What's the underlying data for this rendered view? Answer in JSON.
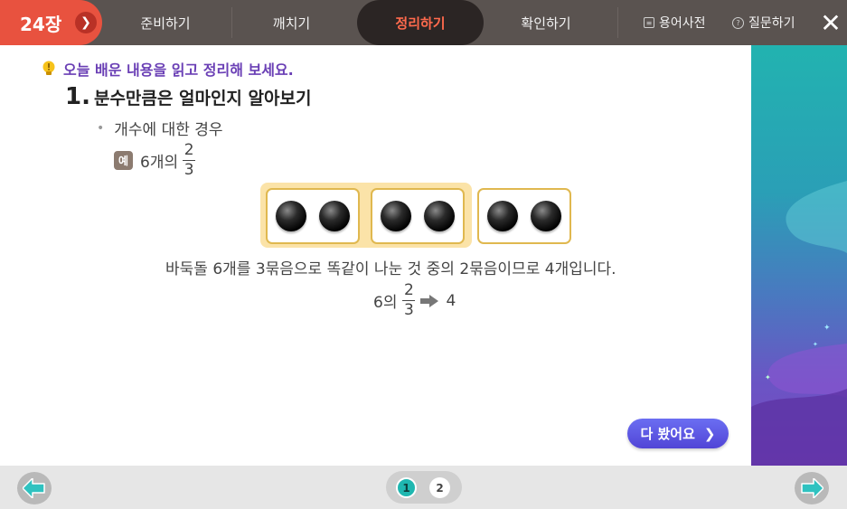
{
  "header": {
    "chapter_label": "24장",
    "tabs": [
      {
        "label": "준비하기"
      },
      {
        "label": "깨치기"
      },
      {
        "label": "정리하기"
      },
      {
        "label": "확인하기"
      }
    ],
    "active_tab": "정리하기",
    "dictionary_label": "용어사전",
    "question_label": "질문하기"
  },
  "content": {
    "goal": "오늘 배운 내용을 읽고 정리해 보세요.",
    "title_number": "1.",
    "title": "분수만큼은 얼마인지 알아보기",
    "bullet": "개수에 대한 경우",
    "example_badge": "예",
    "example_prefix": "6개의",
    "example_numerator": "2",
    "example_denominator": "3",
    "stones_total": 6,
    "groups": 3,
    "highlighted_groups": 2,
    "explanation": "바둑돌 6개를 3묶음으로 똑같이 나눈 것 중의 2묶음이므로 4개입니다.",
    "result_prefix": "6의",
    "result_numerator": "2",
    "result_denominator": "3",
    "result_value": "4",
    "done_button": "다 봤어요"
  },
  "pager": {
    "pages": [
      "1",
      "2"
    ],
    "current": "1"
  },
  "colors": {
    "accent_orange": "#e8523f",
    "goal_purple": "#6a3fb5",
    "group_highlight": "#fbe3a8",
    "box_border": "#e0b84f",
    "done_button": "#5a55e0",
    "pager_active": "#1fb7b0"
  }
}
